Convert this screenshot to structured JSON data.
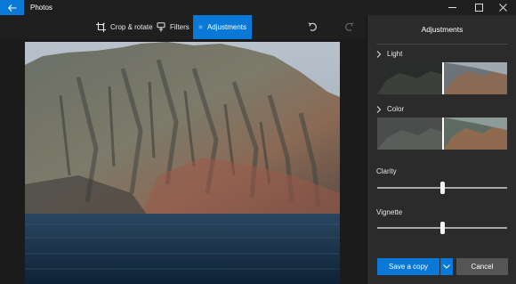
{
  "window": {
    "title": "Photos",
    "controls": [
      "minimize-icon",
      "maximize-icon",
      "close-icon"
    ]
  },
  "toolbar": {
    "crop_label": "Crop & rotate",
    "filters_label": "Filters",
    "adjustments_label": "Adjustments",
    "active_tab": "Adjustments"
  },
  "panel": {
    "title": "Adjustments",
    "light_label": "Light",
    "color_label": "Color",
    "clarity_label": "Clarity",
    "vignette_label": "Vignette",
    "clarity_value": 0.5,
    "vignette_value": 0.5,
    "save_label": "Save a copy",
    "cancel_label": "Cancel"
  },
  "colors": {
    "accent": "#0a78d7",
    "background": "#1f1f1f",
    "panel": "#2b2b2b",
    "cancel": "#555555"
  }
}
